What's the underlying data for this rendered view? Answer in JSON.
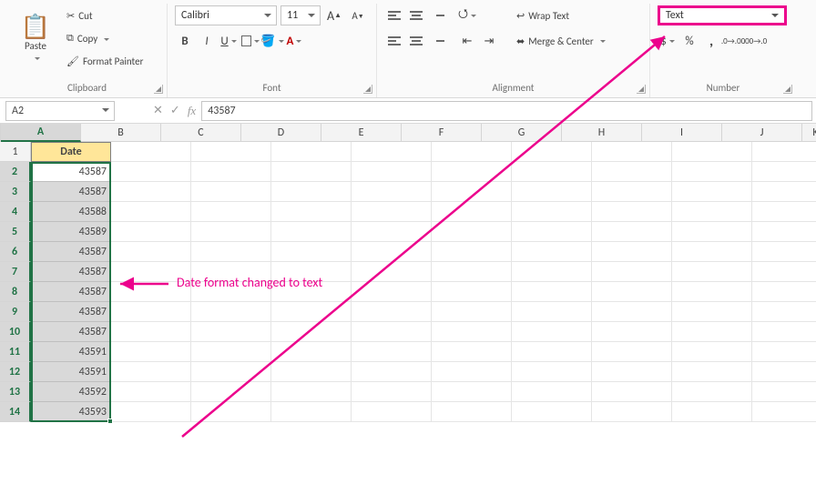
{
  "ribbon": {
    "paste_label": "Paste",
    "cut_label": "Cut",
    "copy_label": "Copy",
    "format_painter_label": "Format Painter",
    "group_clipboard": "Clipboard",
    "font_name": "Calibri",
    "font_size": "11",
    "increase_font_glyph": "A",
    "decrease_font_glyph": "A",
    "bold_glyph": "B",
    "italic_glyph": "I",
    "underline_glyph": "U",
    "group_font": "Font",
    "wrap_text_label": "Wrap Text",
    "merge_center_label": "Merge & Center",
    "group_alignment": "Alignment",
    "number_format": "Text",
    "currency_glyph": "$",
    "percent_glyph": "%",
    "comma_glyph": ",",
    "inc_dec_label": ".0",
    "group_number": "Number"
  },
  "formula_bar": {
    "name_box": "A2",
    "cancel_glyph": "✕",
    "enter_glyph": "✓",
    "fx_label": "fx",
    "formula_value": "43587"
  },
  "grid": {
    "columns": [
      "A",
      "B",
      "C",
      "D",
      "E",
      "F",
      "G",
      "H",
      "I",
      "J",
      "K"
    ],
    "header_cell": "Date",
    "data": [
      "43587",
      "43587",
      "43588",
      "43589",
      "43587",
      "43587",
      "43587",
      "43587",
      "43587",
      "43591",
      "43591",
      "43592",
      "43593"
    ],
    "first_row_num": 1,
    "last_row_num": 14
  },
  "annotation": {
    "text": "Date format changed to text"
  }
}
